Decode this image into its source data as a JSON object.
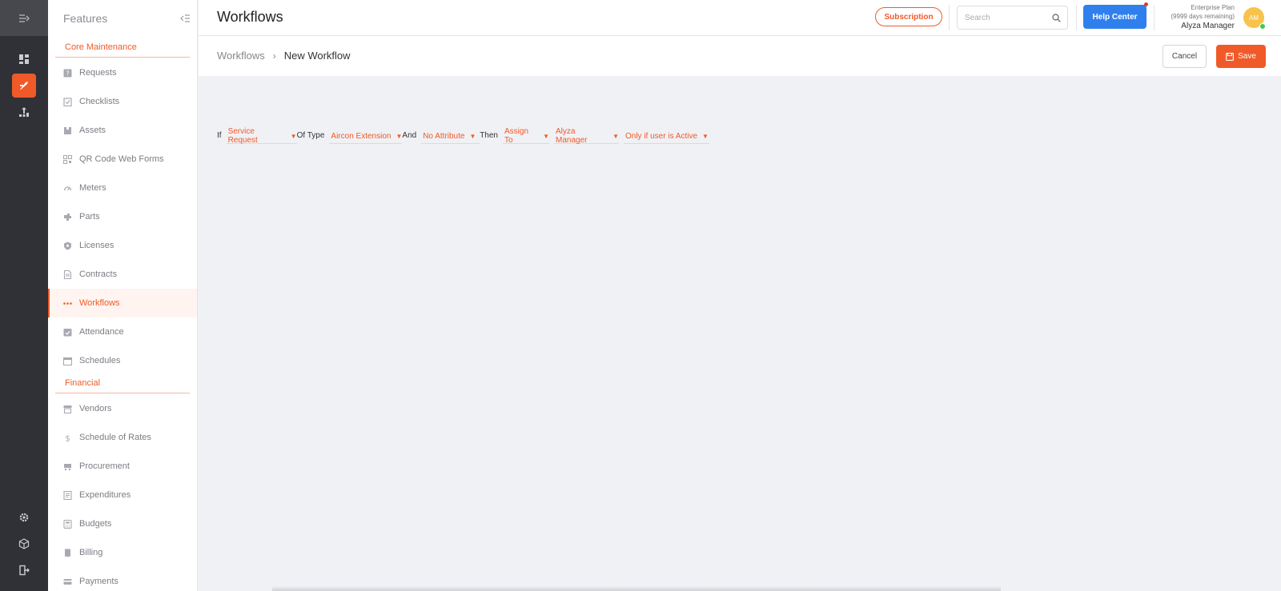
{
  "rail": {
    "icons": [
      "menu-expand-icon",
      "dashboard-icon",
      "maintenance-icon",
      "analytics-icon",
      "settings-icon",
      "package-icon",
      "logout-icon"
    ]
  },
  "features": {
    "title": "Features",
    "section_core": "Core Maintenance",
    "core_items": [
      {
        "label": "Requests",
        "icon": "request-icon"
      },
      {
        "label": "Checklists",
        "icon": "checklist-icon"
      },
      {
        "label": "Assets",
        "icon": "asset-icon"
      },
      {
        "label": "QR Code Web Forms",
        "icon": "qr-code-icon"
      },
      {
        "label": "Meters",
        "icon": "meter-icon"
      },
      {
        "label": "Parts",
        "icon": "parts-icon"
      },
      {
        "label": "Licenses",
        "icon": "license-icon"
      },
      {
        "label": "Contracts",
        "icon": "contract-icon"
      },
      {
        "label": "Workflows",
        "icon": "workflow-icon",
        "active": true
      },
      {
        "label": "Attendance",
        "icon": "attendance-icon"
      },
      {
        "label": "Schedules",
        "icon": "calendar-icon"
      }
    ],
    "section_financial": "Financial",
    "financial_items": [
      {
        "label": "Vendors",
        "icon": "vendor-icon"
      },
      {
        "label": "Schedule of Rates",
        "icon": "dollar-icon"
      },
      {
        "label": "Procurement",
        "icon": "procurement-icon"
      },
      {
        "label": "Expenditures",
        "icon": "expenditure-icon"
      },
      {
        "label": "Budgets",
        "icon": "budget-icon"
      },
      {
        "label": "Billing",
        "icon": "billing-icon"
      },
      {
        "label": "Payments",
        "icon": "payment-icon"
      }
    ]
  },
  "header": {
    "title": "Workflows",
    "subscription_label": "Subscription",
    "search_placeholder": "Search",
    "help_label": "Help Center",
    "plan_name": "Enterprise Plan",
    "plan_remaining": "(9999 days remaining)",
    "user_name": "Alyza Manager",
    "avatar_initials": "AM"
  },
  "breadcrumb": {
    "parent": "Workflows",
    "separator": "›",
    "current": "New Workflow"
  },
  "actions": {
    "cancel_label": "Cancel",
    "save_label": "Save"
  },
  "rule": {
    "if_kw": "If",
    "request_type": "Service Request",
    "of_type_kw": "Of Type",
    "type_value": "Aircon Extension",
    "and_kw": "And",
    "attribute": "No Attribute",
    "then_kw": "Then",
    "action": "Assign To",
    "assignee": "Alyza Manager",
    "condition": "Only if user is Active"
  },
  "colors": {
    "accent": "#f05a28",
    "primary_blue": "#2f80ed",
    "rail_bg": "#2f3136",
    "canvas_bg": "#f0f1f5"
  }
}
